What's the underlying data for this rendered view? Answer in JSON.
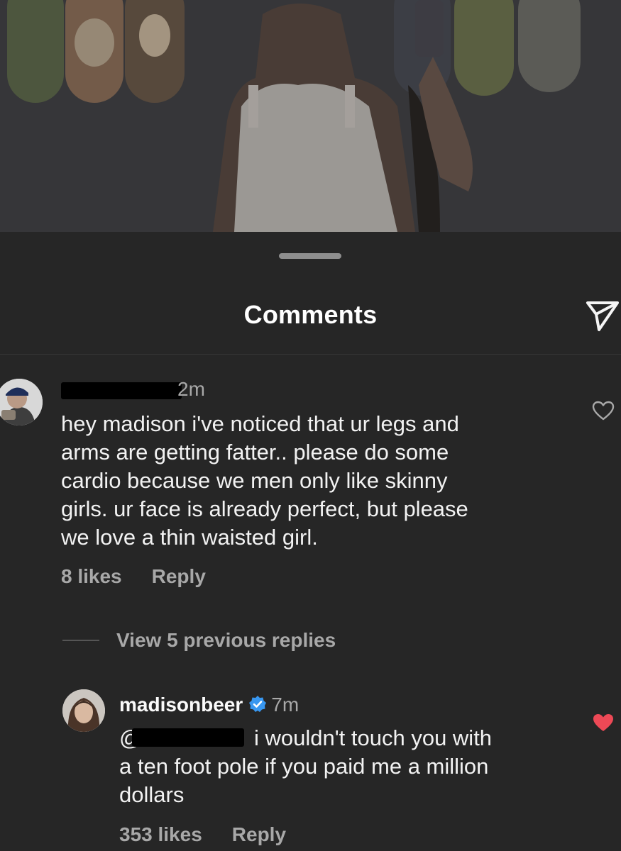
{
  "sheet": {
    "title": "Comments"
  },
  "comment": {
    "username": "",
    "time": "2m",
    "text": "hey madison i've noticed that ur legs and arms are getting fatter.. please do some cardio because we men only like skinny girls. ur face is already perfect, but please we love a thin waisted girl.",
    "lines": [
      "hey madison i've noticed that ur legs and",
      "arms are getting fatter.. please do some",
      "cardio because we men only like skinny",
      "girls. ur face is already perfect, but please",
      "we love a thin waisted girl."
    ],
    "likes": "8 likes",
    "reply_label": "Reply",
    "liked": false
  },
  "view_replies": "View 5 previous replies",
  "reply": {
    "username": "madisonbeer",
    "verified": true,
    "time": "7m",
    "mention_prefix": "@",
    "text_lines": [
      "i wouldn't touch you with",
      "a ten foot pole if you paid me a million",
      "dollars"
    ],
    "likes": "353 likes",
    "reply_label": "Reply",
    "liked": true
  },
  "colors": {
    "background": "#262626",
    "secondary_text": "#a8a8a8",
    "like_red": "#ed4956",
    "verified_blue": "#3897f0"
  }
}
